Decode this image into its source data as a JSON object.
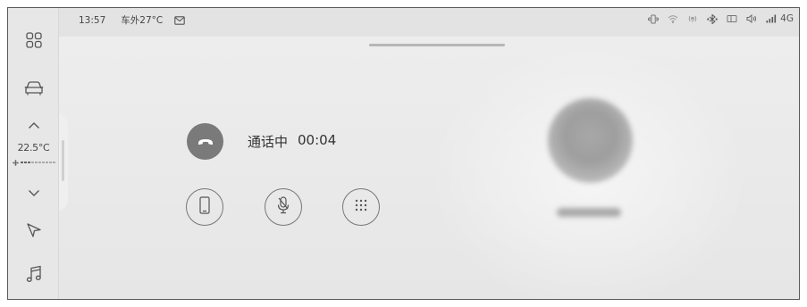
{
  "status_bar": {
    "time": "13:57",
    "outside_temp": "车外27°C",
    "network": "4G",
    "icons": [
      "message-icon",
      "vibrate-icon",
      "wifi-icon",
      "hotspot-icon",
      "bluetooth-icon",
      "screen-cast-icon",
      "volume-icon",
      "signal-icon"
    ]
  },
  "sidebar": {
    "items": [
      "apps-icon",
      "car-icon",
      "chevron-up-icon",
      "chevron-down-icon",
      "navigation-icon",
      "music-icon"
    ],
    "climate": {
      "temp": "22.5°C",
      "fan_level": 3,
      "fan_max": 10
    }
  },
  "call": {
    "status_label": "通话中",
    "duration": "00:04",
    "controls": [
      "handset-mode-icon",
      "mute-microphone-icon",
      "dialpad-icon"
    ]
  },
  "colors": {
    "screen_bg": "#e8e8e8",
    "hangup_bg": "#7a7a7a",
    "icon": "#555555"
  }
}
